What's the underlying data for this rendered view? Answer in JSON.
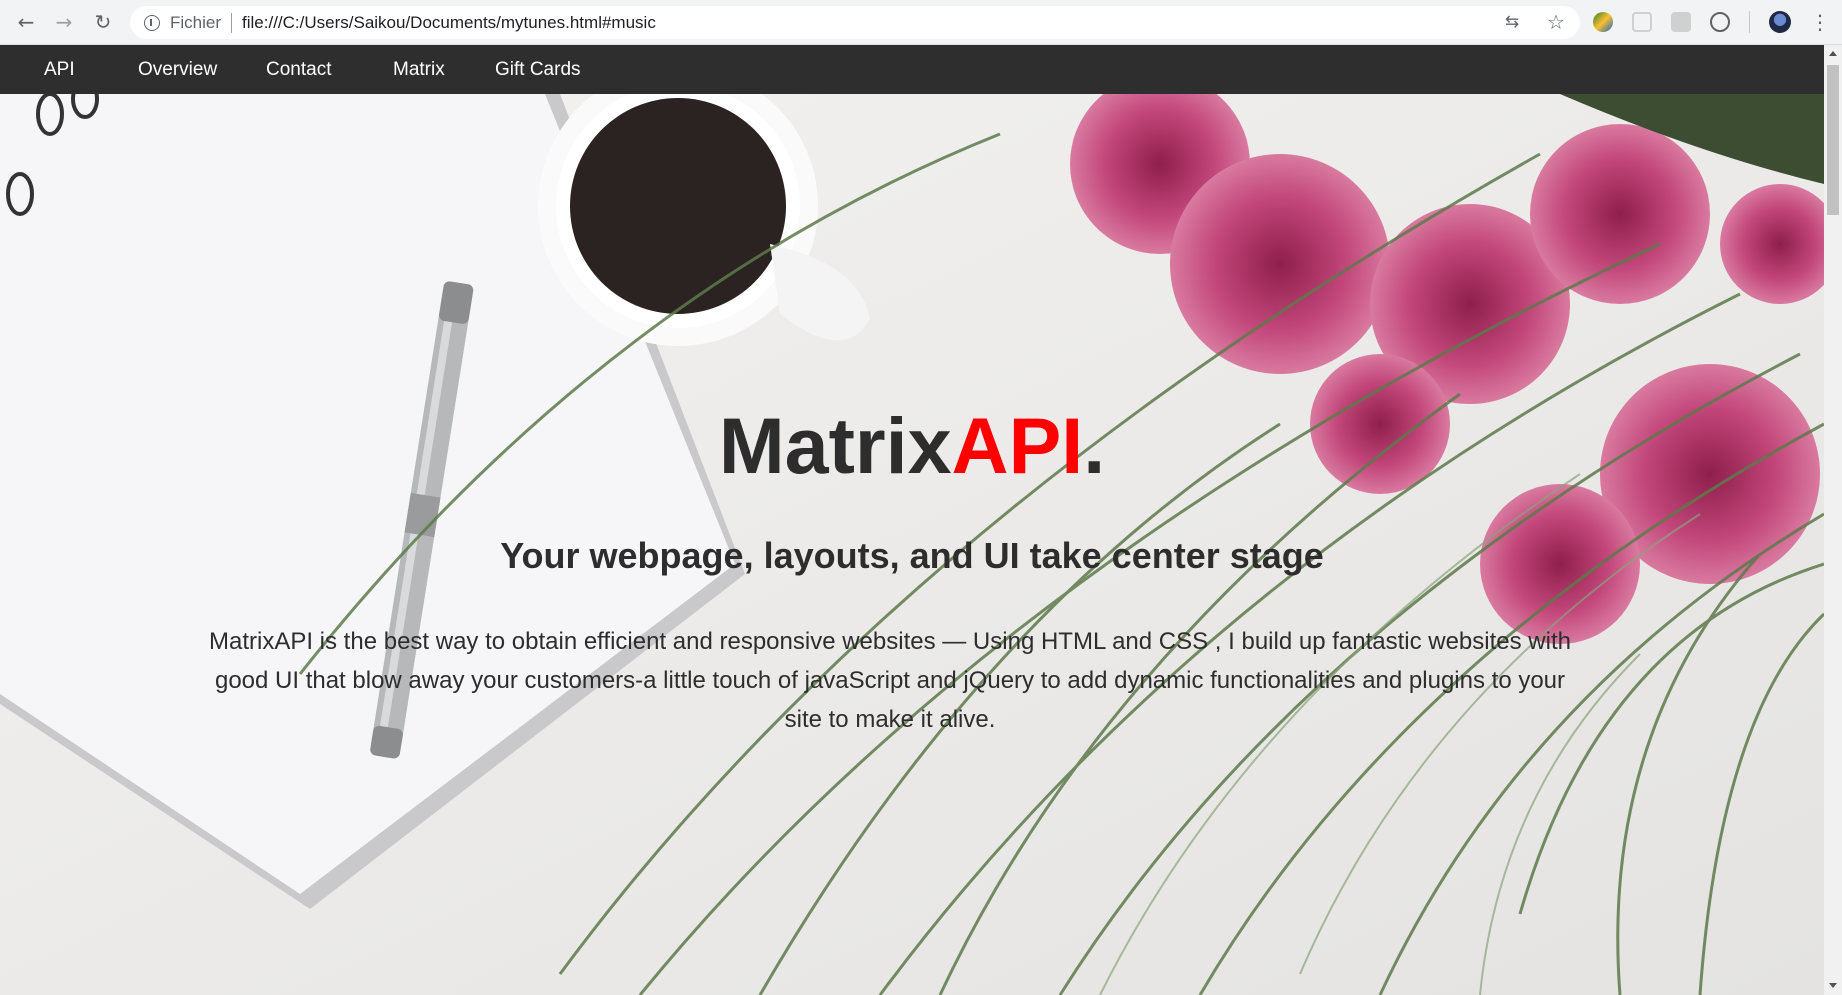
{
  "browser": {
    "back_icon": "←",
    "forward_icon": "→",
    "reload_icon": "↻",
    "scheme_label": "Fichier",
    "url": "file:///C:/Users/Saikou/Documents/mytunes.html#music",
    "translate_icon": "⇆",
    "star_icon": "☆",
    "menu_icon": "⋮"
  },
  "navbar": {
    "items": [
      "API",
      "Overview",
      "Contact",
      "Matrix",
      "Gift Cards"
    ]
  },
  "hero": {
    "title_main": "Matrix",
    "title_accent": "API",
    "title_dot": ".",
    "accent_color": "#ff0000",
    "subtitle": "Your webpage, layouts, and UI take center stage",
    "description": "MatrixAPI is the best way to obtain efficient and responsive websites — Using HTML and CSS , I build up fantastic websites with good UI that blow away your customers-a little touch of javaScript and jQuery to add dynamic functionalities and plugins to your site to make it alive."
  }
}
